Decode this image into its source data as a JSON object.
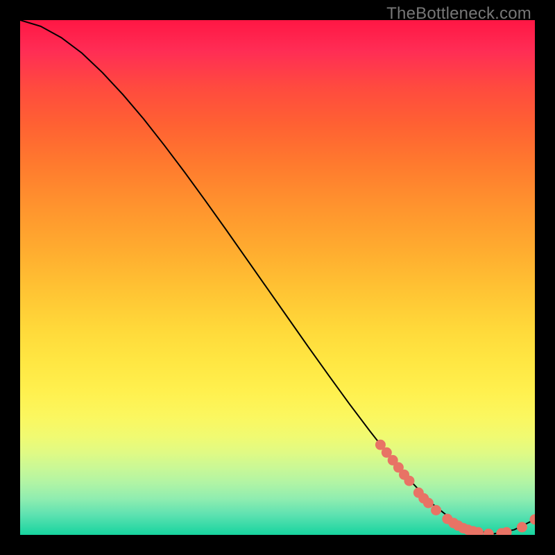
{
  "watermark": "TheBottleneck.com",
  "chart_data": {
    "type": "line",
    "title": "",
    "xlabel": "",
    "ylabel": "",
    "xlim": [
      0,
      100
    ],
    "ylim": [
      0,
      100
    ],
    "series": [
      {
        "name": "curve",
        "x": [
          0,
          4,
          8,
          12,
          16,
          20,
          24,
          28,
          32,
          36,
          40,
          44,
          48,
          52,
          56,
          60,
          64,
          68,
          72,
          76,
          80,
          84,
          88,
          92,
          96,
          100
        ],
        "y": [
          100,
          98.8,
          96.6,
          93.6,
          89.8,
          85.5,
          80.8,
          75.7,
          70.4,
          64.9,
          59.3,
          53.6,
          47.9,
          42.2,
          36.5,
          30.9,
          25.4,
          20.1,
          15.0,
          10.3,
          6.1,
          2.9,
          0.9,
          0.2,
          1.0,
          3.0
        ]
      }
    ],
    "markers": [
      {
        "x": 70.0,
        "y": 17.5
      },
      {
        "x": 71.2,
        "y": 16.0
      },
      {
        "x": 72.4,
        "y": 14.5
      },
      {
        "x": 73.5,
        "y": 13.1
      },
      {
        "x": 74.6,
        "y": 11.7
      },
      {
        "x": 75.6,
        "y": 10.5
      },
      {
        "x": 77.4,
        "y": 8.2
      },
      {
        "x": 78.4,
        "y": 7.1
      },
      {
        "x": 79.3,
        "y": 6.2
      },
      {
        "x": 80.8,
        "y": 4.8
      },
      {
        "x": 83.0,
        "y": 3.1
      },
      {
        "x": 84.2,
        "y": 2.3
      },
      {
        "x": 85.1,
        "y": 1.8
      },
      {
        "x": 86.1,
        "y": 1.3
      },
      {
        "x": 87.0,
        "y": 1.0
      },
      {
        "x": 88.0,
        "y": 0.7
      },
      {
        "x": 89.0,
        "y": 0.5
      },
      {
        "x": 91.0,
        "y": 0.2
      },
      {
        "x": 93.5,
        "y": 0.3
      },
      {
        "x": 94.5,
        "y": 0.5
      },
      {
        "x": 97.5,
        "y": 1.5
      },
      {
        "x": 100.0,
        "y": 3.0
      }
    ],
    "colors": {
      "curve": "#000000",
      "markers": "#e87365"
    }
  }
}
